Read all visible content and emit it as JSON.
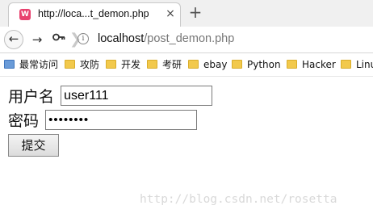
{
  "browser": {
    "tab": {
      "title": "http://loca...t_demon.php",
      "favicon": "webide-icon",
      "close": "×"
    },
    "new_tab": "+",
    "nav": {
      "back": "←",
      "forward": "→",
      "tools": "🔑",
      "info": "i"
    },
    "url": {
      "host": "localhost",
      "path": "/post_demon.php"
    },
    "bookmarks": [
      {
        "label": "最常访问",
        "icon": "star-icon"
      },
      {
        "label": "攻防",
        "icon": "folder-icon"
      },
      {
        "label": "开发",
        "icon": "folder-icon"
      },
      {
        "label": "考研",
        "icon": "folder-icon"
      },
      {
        "label": "ebay",
        "icon": "folder-icon"
      },
      {
        "label": "Python",
        "icon": "folder-icon"
      },
      {
        "label": "Hacker",
        "icon": "folder-icon"
      },
      {
        "label": "Linu",
        "icon": "folder-icon"
      }
    ]
  },
  "form": {
    "username_label": "用户名",
    "username_value": "user111",
    "password_label": "密码",
    "password_value": "••••••••",
    "submit_label": "提交"
  },
  "watermark": "http://blog.csdn.net/rosetta",
  "colors": {
    "tab_strip": "#f0f0f0",
    "favicon": "#e8426f",
    "folder": "#f2c94c",
    "watermark": "#d9d9d9"
  }
}
